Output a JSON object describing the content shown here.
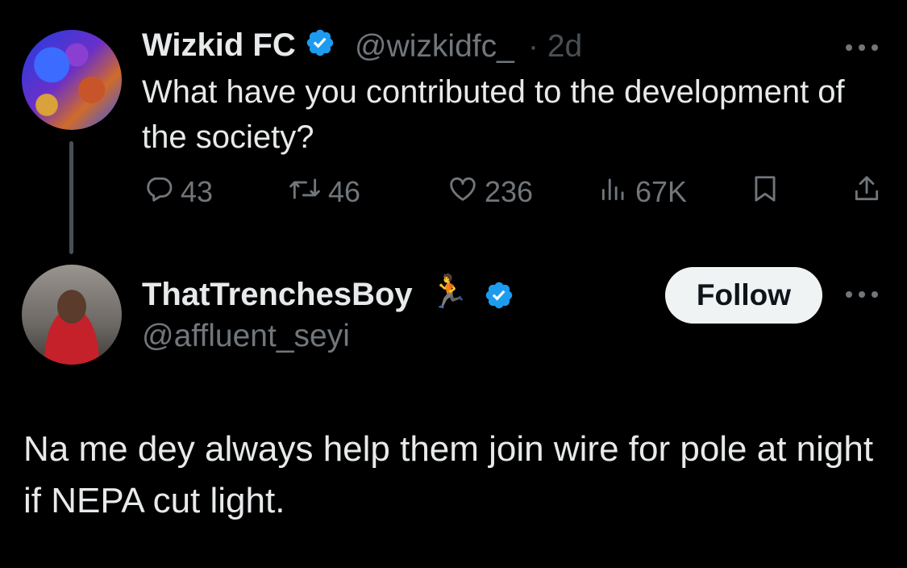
{
  "tweet1": {
    "author_name": "Wizkid FC",
    "handle": "@wizkidfc_",
    "time": "· 2d",
    "text": "What have you contributed to the development of the society?",
    "stats": {
      "replies": "43",
      "reposts": "46",
      "likes": "236",
      "views": "67K"
    }
  },
  "tweet2": {
    "author_name": "ThatTrenchesBoy",
    "name_emoji": "🏃",
    "handle": "@affluent_seyi",
    "follow_label": "Follow",
    "text": "Na me dey always help them join wire for pole at night if NEPA cut light."
  },
  "colors": {
    "background": "#000000",
    "text_primary": "#e7e9ea",
    "text_secondary": "#71767b",
    "verified_blue": "#1d9bf0",
    "follow_bg": "#eff3f4"
  },
  "icons": {
    "reply": "reply-icon",
    "repost": "repost-icon",
    "like": "heart-icon",
    "views": "views-icon",
    "bookmark": "bookmark-icon",
    "share": "share-icon",
    "more": "more-icon",
    "verified": "verified-badge-icon"
  }
}
